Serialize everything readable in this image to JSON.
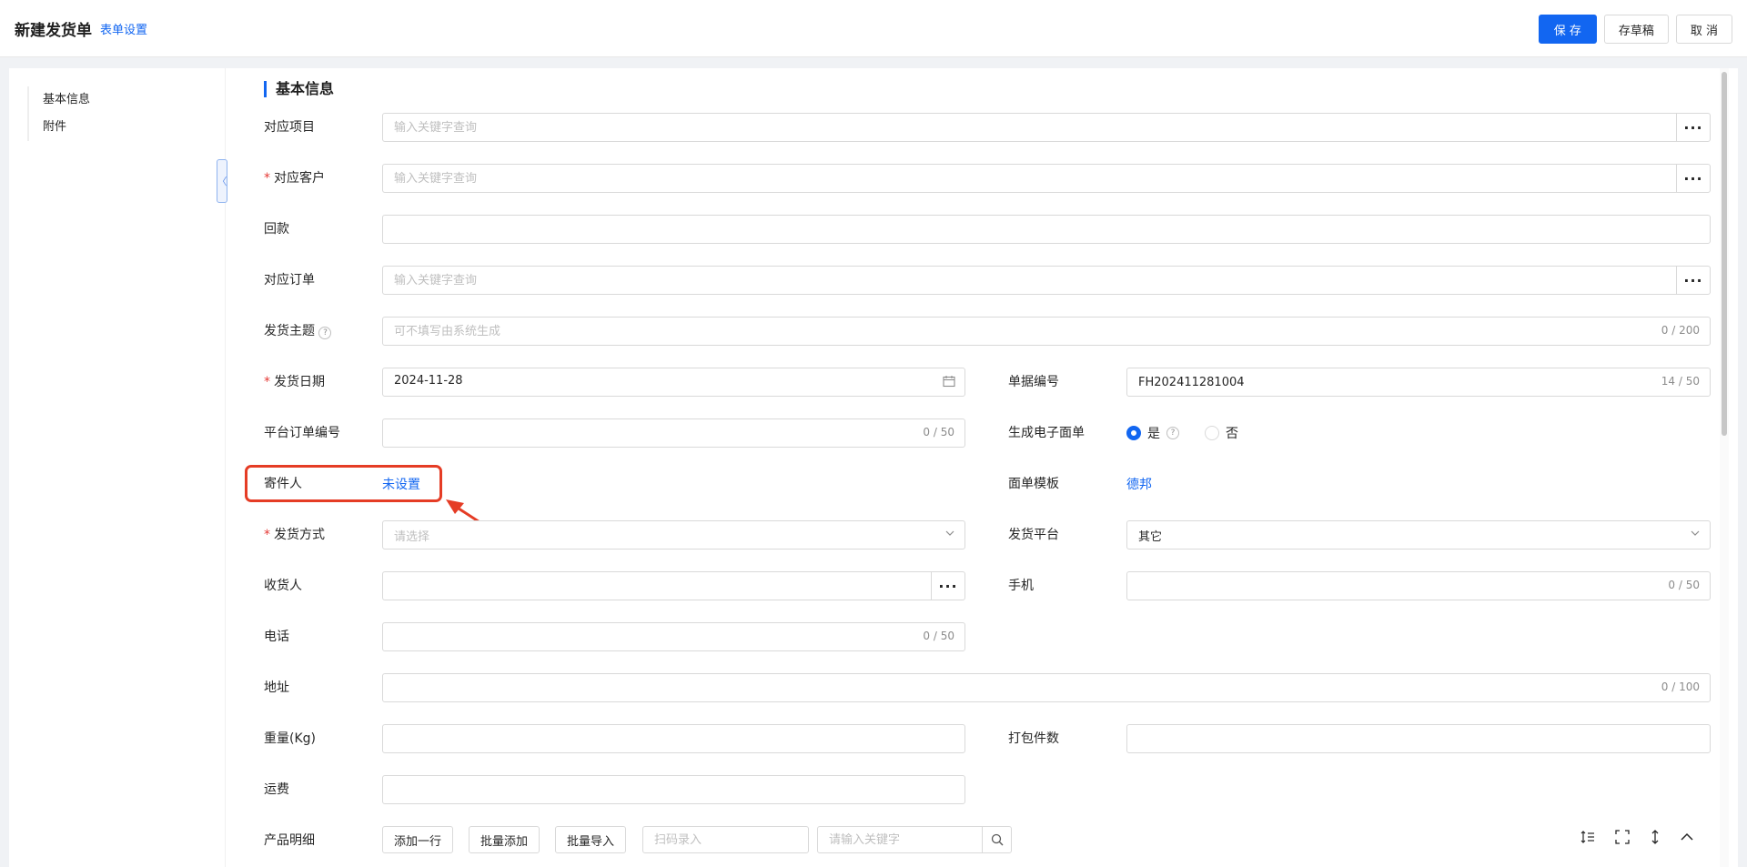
{
  "header": {
    "title": "新建发货单",
    "form_settings": "表单设置",
    "save": "保 存",
    "draft": "存草稿",
    "cancel": "取 消"
  },
  "sidebar": {
    "items": [
      {
        "label": "基本信息"
      },
      {
        "label": "附件"
      }
    ],
    "collapse_glyph": "〈"
  },
  "section": {
    "title": "基本信息"
  },
  "common": {
    "required": "*",
    "more": "···",
    "help": "?"
  },
  "fields": {
    "project": {
      "label": "对应项目",
      "placeholder": "输入关键字查询"
    },
    "customer": {
      "label": "对应客户",
      "placeholder": "输入关键字查询"
    },
    "payment": {
      "label": "回款"
    },
    "order": {
      "label": "对应订单",
      "placeholder": "输入关键字查询"
    },
    "subject": {
      "label": "发货主题",
      "placeholder": "可不填写由系统生成",
      "counter": "0 / 200"
    },
    "ship_date": {
      "label": "发货日期",
      "value": "2024-11-28"
    },
    "doc_no": {
      "label": "单据编号",
      "value": "FH202411281004",
      "counter": "14 / 50"
    },
    "platform_order_no": {
      "label": "平台订单编号",
      "counter": "0 / 50"
    },
    "e_waybill": {
      "label": "生成电子面单",
      "yes": "是",
      "no": "否"
    },
    "sender": {
      "label": "寄件人",
      "value": "未设置"
    },
    "waybill_template": {
      "label": "面单模板",
      "value": "德邦"
    },
    "ship_method": {
      "label": "发货方式",
      "placeholder": "请选择"
    },
    "ship_platform": {
      "label": "发货平台",
      "value": "其它"
    },
    "receiver": {
      "label": "收货人"
    },
    "mobile": {
      "label": "手机",
      "counter": "0 / 50"
    },
    "phone": {
      "label": "电话",
      "counter": "0 / 50"
    },
    "address": {
      "label": "地址",
      "counter": "0 / 100"
    },
    "weight": {
      "label": "重量(Kg)"
    },
    "packages": {
      "label": "打包件数"
    },
    "freight": {
      "label": "运费"
    }
  },
  "products": {
    "label": "产品明细",
    "add_row": "添加一行",
    "batch_add": "批量添加",
    "batch_import": "批量导入",
    "scan_placeholder": "扫码录入",
    "search_placeholder": "请输入关键字"
  },
  "icons": {
    "calendar": "calendar-icon",
    "chevron": "chevron-down-icon",
    "search": "search-icon",
    "arrow": "annotation-arrow"
  },
  "colors": {
    "accent": "#1266f1",
    "required": "#e53935",
    "annotation": "#e53c25"
  }
}
